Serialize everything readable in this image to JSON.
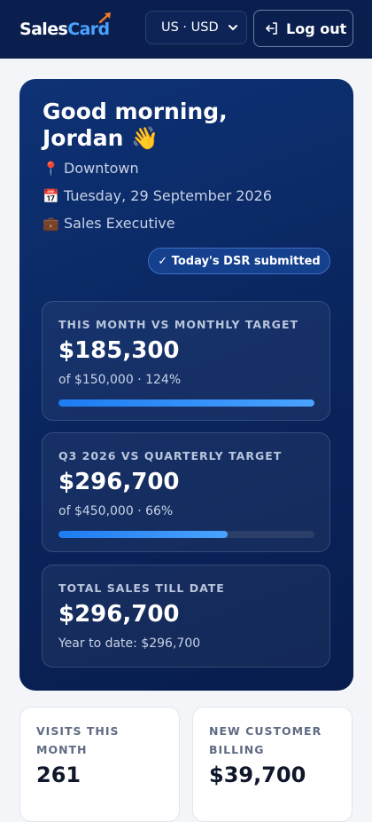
{
  "header": {
    "logo_part1": "Sales",
    "logo_part2": "Card",
    "currency_selected": "US · USD",
    "logout_label": "Log out"
  },
  "hero": {
    "greeting_line1": "Good morning,",
    "greeting_line2": "Jordan 👋",
    "location_icon": "📍",
    "location": "Downtown",
    "date_icon": "📅",
    "date": "Tuesday, 29 September 2026",
    "role_icon": "💼",
    "role": "Sales Executive",
    "dsr_badge": "✓ Today's DSR submitted"
  },
  "stats": [
    {
      "label": "THIS MONTH VS MONTHLY TARGET",
      "value": "$185,300",
      "sub": "of $150,000 · 124%",
      "progress": 1.0
    },
    {
      "label": "Q3 2026 VS QUARTERLY TARGET",
      "value": "$296,700",
      "sub": "of $450,000 · 66%",
      "progress": 0.66
    },
    {
      "label": "TOTAL SALES TILL DATE",
      "value": "$296,700",
      "sub": "Year to date: $296,700"
    }
  ],
  "mini_cards": [
    {
      "label": "VISITS THIS MONTH",
      "value": "261"
    },
    {
      "label": "NEW CUSTOMER BILLING",
      "value": "$39,700"
    }
  ],
  "colors": {
    "header_bg": "#0b1f4f",
    "accent": "#4aa3ff",
    "progress": "#1d7cf2"
  },
  "icons": {
    "logo": "sales-card-logo-arrow-icon",
    "currency": "chevron-down-icon",
    "logout": "logout-icon"
  }
}
